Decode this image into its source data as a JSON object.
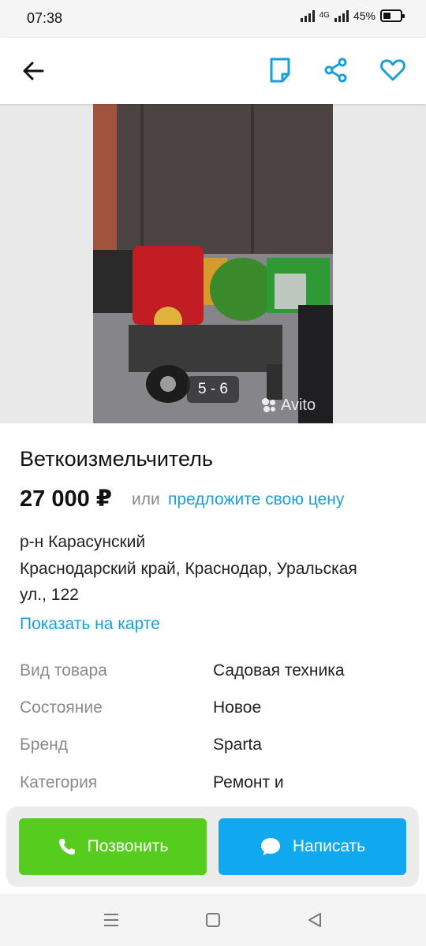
{
  "status_bar": {
    "time": "07:38",
    "network": "4G",
    "battery": "45%"
  },
  "app_bar": {
    "back_icon": "arrow-left-icon",
    "icons": [
      "note-icon",
      "share-icon",
      "heart-icon"
    ],
    "accent_color": "#1a9fd9"
  },
  "gallery": {
    "counter": "5 - 6",
    "watermark": "Avito"
  },
  "listing": {
    "title": "Веткоизмельчитель",
    "price": "27 000 ₽",
    "or_text": "или",
    "offer_link": "предложите свою цену",
    "district": "р-н Карасунский",
    "address_line1": "Краснодарский край, Краснодар, Уральская",
    "address_line2": "ул., 122",
    "map_link": "Показать на карте"
  },
  "params": [
    {
      "label": "Вид товара",
      "value": "Садовая техника"
    },
    {
      "label": "Состояние",
      "value": "Новое"
    },
    {
      "label": "Бренд",
      "value": "Sparta"
    },
    {
      "label": "Категория",
      "value": "Ремонт и"
    }
  ],
  "actions": {
    "call_label": "Позвонить",
    "write_label": "Написать",
    "call_color": "#55cc1e",
    "write_color": "#10a9f0"
  },
  "nav_icons": [
    "menu-icon",
    "home-square-icon",
    "back-triangle-icon"
  ]
}
